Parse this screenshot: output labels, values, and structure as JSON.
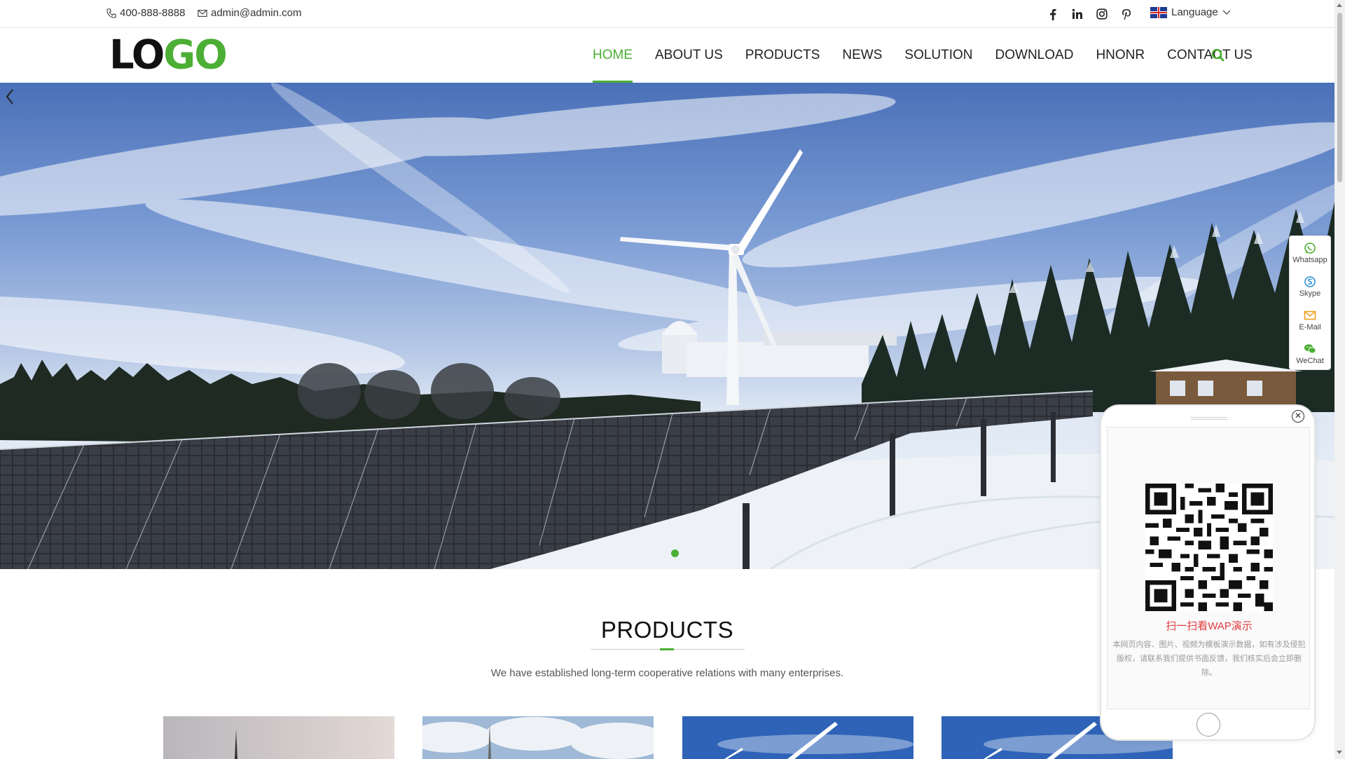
{
  "topbar": {
    "phone": "400-888-8888",
    "email": "admin@admin.com",
    "language_label": "Language"
  },
  "social_icons": [
    "facebook-icon",
    "linkedin-icon",
    "instagram-icon",
    "pinterest-icon"
  ],
  "logo": {
    "part1": "LO",
    "part2": "GO"
  },
  "nav": {
    "items": [
      {
        "label": "HOME",
        "active": true
      },
      {
        "label": "ABOUT US"
      },
      {
        "label": "PRODUCTS"
      },
      {
        "label": "NEWS"
      },
      {
        "label": "SOLUTION"
      },
      {
        "label": "DOWNLOAD"
      },
      {
        "label": "HNONR"
      },
      {
        "label": "CONTACT US"
      }
    ]
  },
  "hero": {
    "slide_index": 1,
    "slide_count": 1
  },
  "products": {
    "title": "PRODUCTS",
    "subtitle": "We have established long-term cooperative relations with many enterprises."
  },
  "side_float": {
    "items": [
      {
        "label": "Whatsapp",
        "icon": "whatsapp-icon"
      },
      {
        "label": "Skype",
        "icon": "skype-icon"
      },
      {
        "label": "E-Mail",
        "icon": "mail-icon"
      },
      {
        "label": "WeChat",
        "icon": "wechat-icon"
      }
    ]
  },
  "phone_popup": {
    "scan_text": "扫一扫看WAP演示",
    "notice": "本网页内容、图片、视频为模板演示数据，如有涉及侵犯版权，请联系我们提供书面反馈，我们核实后会立即删除。"
  },
  "colors": {
    "accent": "#4caf35",
    "scan_text": "#e0393e"
  }
}
